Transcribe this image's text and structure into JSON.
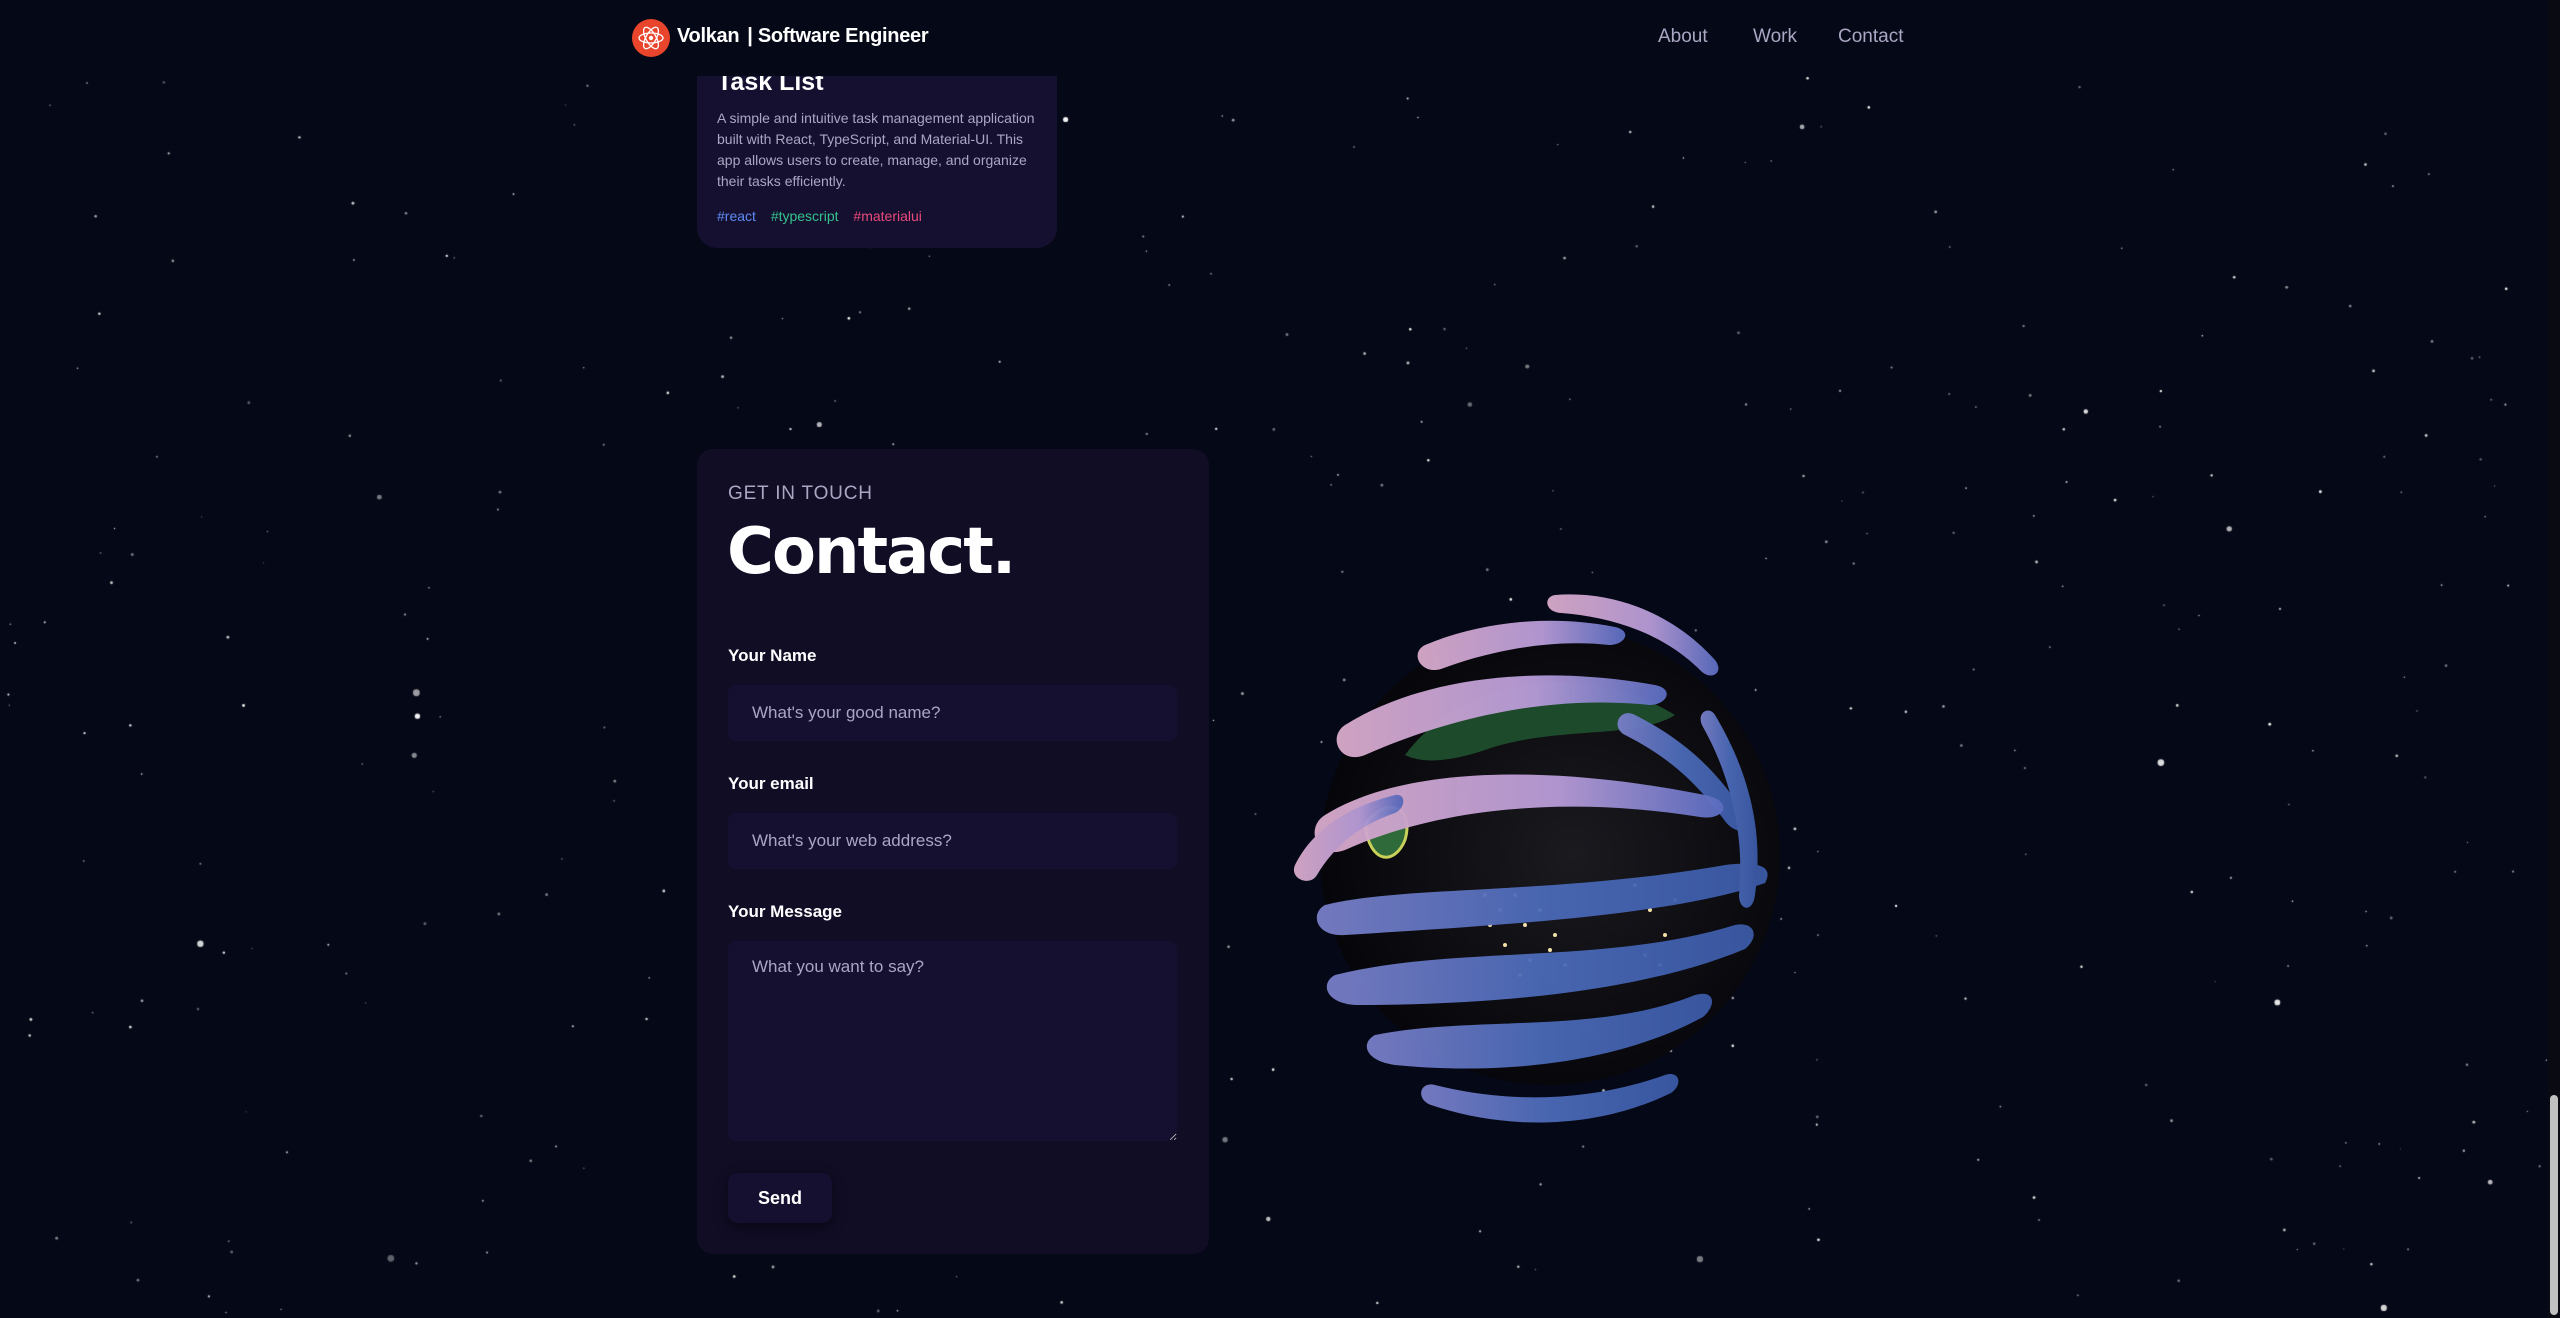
{
  "nav": {
    "brand_name": "Volkan",
    "brand_suffix": "| Software Engineer",
    "links": [
      "About",
      "Work",
      "Contact"
    ]
  },
  "project": {
    "title": "Task List",
    "description": "A simple and intuitive task management application built with React, TypeScript, and Material-UI. This app allows users to create, manage, and organize their tasks efficiently.",
    "tags": [
      {
        "name": "#react",
        "color": "#5d8bf4"
      },
      {
        "name": "#typescript",
        "color": "#35c28c"
      },
      {
        "name": "#materialui",
        "color": "#e84a7a"
      }
    ]
  },
  "contact": {
    "subtitle": "GET IN TOUCH",
    "title": "Contact.",
    "name_label": "Your Name",
    "name_placeholder": "What's your good name?",
    "email_label": "Your email",
    "email_placeholder": "What's your web address?",
    "message_label": "Your Message",
    "message_placeholder": "What you want to say?",
    "send_label": "Send"
  },
  "colors": {
    "background": "#050816",
    "card": "#151030",
    "contact_panel": "#100d25",
    "secondary_text": "#aaa6c3",
    "logo": "#e8452c"
  },
  "icons": [
    "atom-logo-icon",
    "earth-globe-icon"
  ]
}
